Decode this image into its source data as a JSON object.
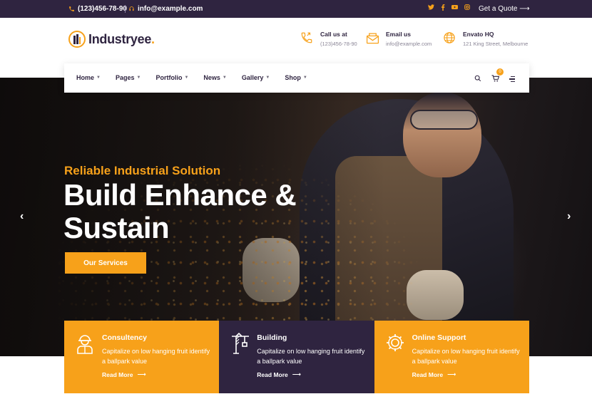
{
  "topbar": {
    "phone": "(123)456-78-90",
    "email": "info@example.com",
    "socials": [
      "twitter-icon",
      "facebook-icon",
      "youtube-icon",
      "instagram-icon"
    ],
    "quote_label": "Get a Quote"
  },
  "brand": {
    "name": "Industryee",
    "dot": "."
  },
  "contacts": [
    {
      "title": "Call us at",
      "value": "(123)456-78-90",
      "icon": "phone-icon"
    },
    {
      "title": "Email us",
      "value": "info@example.com",
      "icon": "mail-icon"
    },
    {
      "title": "Envato HQ",
      "value": "121 King Street, Melbourne",
      "icon": "globe-icon"
    }
  ],
  "nav": {
    "items": [
      "Home",
      "Pages",
      "Portfolio",
      "News",
      "Gallery",
      "Shop"
    ],
    "cart_count": "0"
  },
  "hero": {
    "kicker": "Reliable Industrial Solution",
    "headline_line1": "Build Enhance &",
    "headline_line2": "Sustain",
    "cta_label": "Our Services"
  },
  "cards": [
    {
      "title": "Consultency",
      "text": "Capitalize on low hanging fruit identify a ballpark value",
      "link": "Read More",
      "icon": "worker-icon"
    },
    {
      "title": "Building",
      "text": "Capitalize on low hanging fruit identify a ballpark value",
      "link": "Read More",
      "icon": "crane-icon"
    },
    {
      "title": "Online Support",
      "text": "Capitalize on low hanging fruit identify a ballpark value",
      "link": "Read More",
      "icon": "gear-icon"
    }
  ],
  "colors": {
    "accent": "#f7a11a",
    "dark": "#2f2440"
  }
}
